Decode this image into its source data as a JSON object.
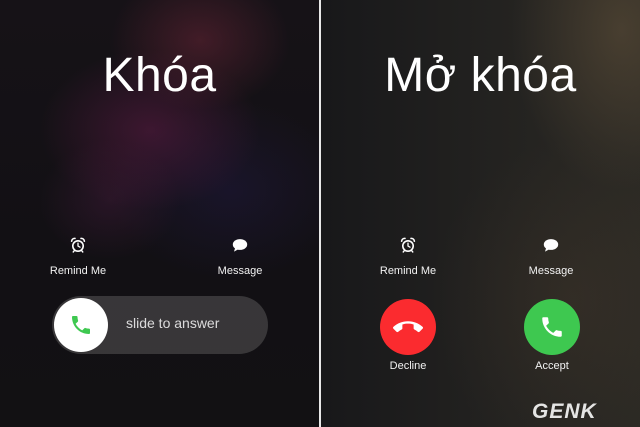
{
  "left_panel": {
    "title": "Khóa",
    "remind_label": "Remind Me",
    "message_label": "Message",
    "slide_text": "slide to answer"
  },
  "right_panel": {
    "title": "Mở khóa",
    "remind_label": "Remind Me",
    "message_label": "Message",
    "decline_label": "Decline",
    "accept_label": "Accept"
  },
  "watermark": "GENK",
  "icons": {
    "alarm": "alarm-clock-icon",
    "message": "speech-bubble-icon",
    "phone": "phone-icon",
    "hangup": "phone-hangup-icon"
  },
  "colors": {
    "accept_green": "#3ec850",
    "decline_red": "#fb2b2f",
    "slider_phone_green": "#3ec850"
  }
}
